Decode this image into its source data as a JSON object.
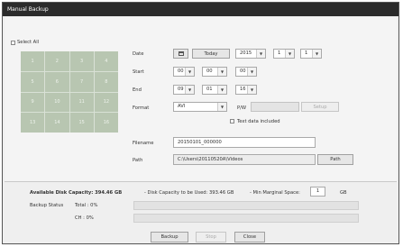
{
  "window": {
    "title": "Manual Backup"
  },
  "select_all": {
    "label": "Select All",
    "checked": false
  },
  "channels": [
    "1",
    "2",
    "3",
    "4",
    "5",
    "6",
    "7",
    "8",
    "9",
    "10",
    "11",
    "12",
    "13",
    "14",
    "15",
    "16"
  ],
  "date": {
    "label": "Date",
    "today_button": "Today",
    "year": "2015",
    "month": "1",
    "day": "1"
  },
  "start": {
    "label": "Start",
    "hour": "00",
    "minute": "00",
    "second": "00"
  },
  "end": {
    "label": "End",
    "hour": "09",
    "minute": "01",
    "second": "16"
  },
  "format": {
    "label": "Format",
    "value": "AVI",
    "pw_label": "P/W",
    "pw_value": "",
    "setup_button": "Setup",
    "text_data_label": "Text data included",
    "text_data_checked": false
  },
  "filename": {
    "label": "Filename",
    "value": "20150101_000000"
  },
  "path": {
    "label": "Path",
    "value": "C:\\Users\\20110520A\\Videos",
    "button": "Path"
  },
  "capacity": {
    "available_text": "Available Disk Capacity: 394.46 GB",
    "to_be_used_text": "- Disk Capacity to be Used: 393.46 GB",
    "marginal_label": "- Min Marginal Space:",
    "marginal_value": "1",
    "marginal_unit": "GB"
  },
  "backup_status": {
    "label": "Backup Status",
    "total_label": "Total : 0%",
    "ch_label": "CH : 0%",
    "total_progress": 0,
    "ch_progress": 0
  },
  "buttons": {
    "backup": "Backup",
    "stop": "Stop",
    "close": "Close"
  },
  "colors": {
    "titlebar": "#2b2b2b",
    "channel_cell": "#b8c6b1",
    "progress": "#4a8fd6"
  }
}
